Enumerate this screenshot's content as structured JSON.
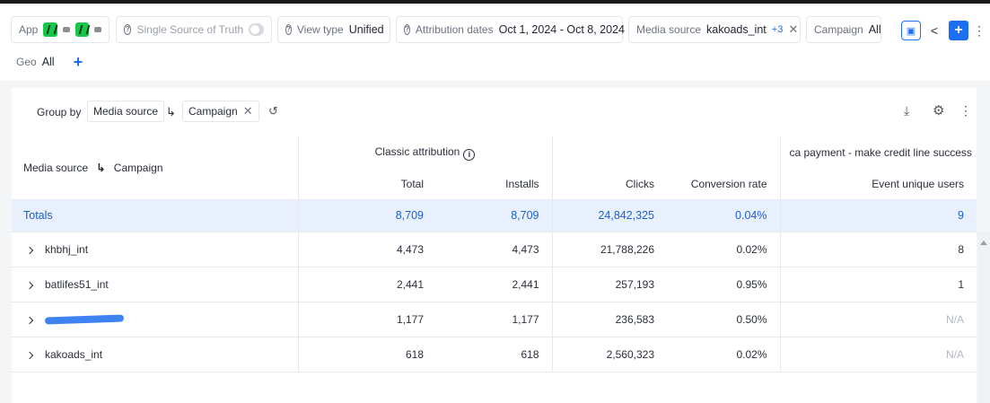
{
  "filters": {
    "app": {
      "label": "App"
    },
    "single_source": {
      "label": "Single Source of Truth"
    },
    "view_type": {
      "label": "View type",
      "value": "Unified"
    },
    "attribution_dates": {
      "label": "Attribution dates",
      "value": "Oct 1, 2024 - Oct 8, 2024"
    },
    "media_source": {
      "label": "Media source",
      "value": "kakoads_int",
      "extra": "+3"
    },
    "campaign": {
      "label": "Campaign",
      "value": "All"
    },
    "geo": {
      "label": "Geo",
      "value": "All"
    }
  },
  "groupby": {
    "label": "Group by",
    "items": [
      "Media source",
      "Campaign"
    ]
  },
  "table": {
    "dimension_header": "Media source",
    "dimension_sub": "Campaign",
    "group_header": "Classic attribution",
    "event_header": "ca payment - make credit line success",
    "columns": [
      "Total",
      "Installs",
      "Clicks",
      "Conversion rate",
      "Event unique users"
    ],
    "totals": {
      "label": "Totals",
      "values": [
        "8,709",
        "8,709",
        "24,842,325",
        "0.04%",
        "9"
      ]
    },
    "rows": [
      {
        "name": "khbhj_int",
        "values": [
          "4,473",
          "4,473",
          "21,788,226",
          "0.02%",
          "8"
        ]
      },
      {
        "name": "batlifes51_int",
        "values": [
          "2,441",
          "2,441",
          "257,193",
          "0.95%",
          "1"
        ]
      },
      {
        "name": "",
        "values": [
          "1,177",
          "1,177",
          "236,583",
          "0.50%",
          "N/A"
        ]
      },
      {
        "name": "kakoads_int",
        "values": [
          "618",
          "618",
          "2,560,323",
          "0.02%",
          "N/A"
        ]
      }
    ]
  },
  "colors": {
    "accent": "#1c6ef2",
    "totals_bg": "#e8f0fd"
  }
}
